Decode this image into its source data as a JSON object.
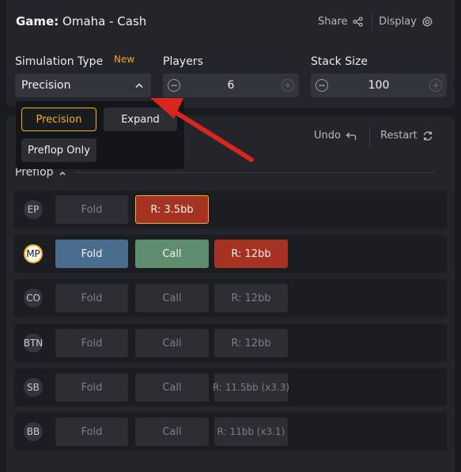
{
  "header": {
    "game_label": "Game:",
    "game_value": "Omaha - Cash",
    "share_label": "Share",
    "display_label": "Display"
  },
  "simulation": {
    "label": "Simulation Type",
    "badge": "New",
    "selected": "Precision",
    "options": [
      "Precision",
      "Expand",
      "Preflop Only"
    ]
  },
  "players": {
    "label": "Players",
    "value": "6"
  },
  "stack": {
    "label": "Stack Size",
    "value": "100"
  },
  "toolbar": {
    "undo_label": "Undo",
    "restart_label": "Restart"
  },
  "section": {
    "title": "Preflop"
  },
  "rows": [
    {
      "position": "EP",
      "actions": [
        "Fold",
        "R: 3.5bb"
      ]
    },
    {
      "position": "MP",
      "actions": [
        "Fold",
        "Call",
        "R: 12bb"
      ]
    },
    {
      "position": "CO",
      "actions": [
        "Fold",
        "Call",
        "R: 12bb"
      ]
    },
    {
      "position": "BTN",
      "actions": [
        "Fold",
        "Call",
        "R: 12bb"
      ]
    },
    {
      "position": "SB",
      "actions": [
        "Fold",
        "Call",
        "R: 11.5bb (x3.3)"
      ]
    },
    {
      "position": "BB",
      "actions": [
        "Fold",
        "Call",
        "R: 11bb (x3.1)"
      ]
    }
  ],
  "colors": {
    "accent": "#f2b21b",
    "fold_active": "#4a6d8f",
    "call_active": "#5e8e6d",
    "raise": "#a63322",
    "annotation_arrow": "#d8261f"
  }
}
